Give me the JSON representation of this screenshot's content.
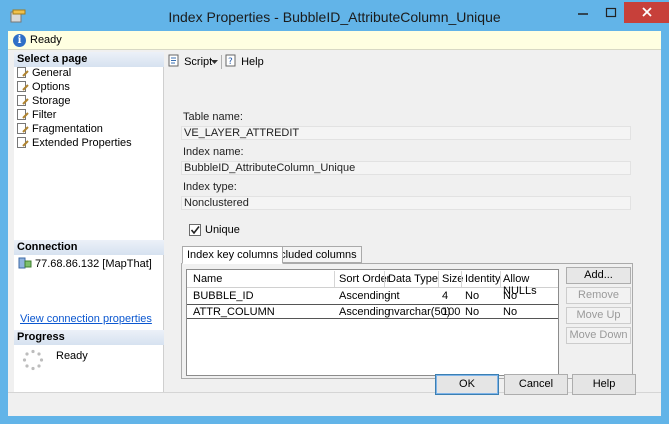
{
  "window": {
    "title": "Index Properties - BubbleID_AttributeColumn_Unique",
    "minimize_label": "minimize",
    "maximize_label": "maximize",
    "close_label": "close"
  },
  "status": {
    "text": "Ready",
    "icon": "info-icon"
  },
  "left": {
    "select_page_header": "Select a page",
    "pages": [
      {
        "label": "General"
      },
      {
        "label": "Options"
      },
      {
        "label": "Storage"
      },
      {
        "label": "Filter"
      },
      {
        "label": "Fragmentation"
      },
      {
        "label": "Extended Properties"
      }
    ],
    "connection_header": "Connection",
    "connection_server": "77.68.86.132 [MapThat]",
    "connection_link": "View connection properties",
    "progress_header": "Progress",
    "progress_text": "Ready"
  },
  "toolbar": {
    "script_label": "Script",
    "help_label": "Help"
  },
  "form": {
    "table_name_label": "Table name:",
    "table_name_value": "VE_LAYER_ATTREDIT",
    "index_name_label": "Index name:",
    "index_name_value": "BubbleID_AttributeColumn_Unique",
    "index_type_label": "Index type:",
    "index_type_value": "Nonclustered",
    "unique_label": "Unique",
    "unique_checked": true
  },
  "tabs": [
    {
      "label": "Index key columns",
      "active": true
    },
    {
      "label": "Included columns",
      "active": false
    }
  ],
  "grid": {
    "headers": [
      "Name",
      "Sort Order",
      "Data Type",
      "Size",
      "Identity",
      "Allow NULLs"
    ],
    "rows": [
      [
        "BUBBLE_ID",
        "Ascending",
        "int",
        "4",
        "No",
        "No"
      ],
      [
        "ATTR_COLUMN",
        "Ascending",
        "nvarchar(50)",
        "100",
        "No",
        "No"
      ]
    ]
  },
  "side_buttons": {
    "add": "Add...",
    "remove": "Remove",
    "move_up": "Move Up",
    "move_down": "Move Down"
  },
  "dialog_buttons": {
    "ok": "OK",
    "cancel": "Cancel",
    "help": "Help"
  },
  "colors": {
    "frame": "#62b4e8",
    "close": "#c7403a",
    "status_bg": "#ffffe1",
    "link": "#0b57d0"
  }
}
